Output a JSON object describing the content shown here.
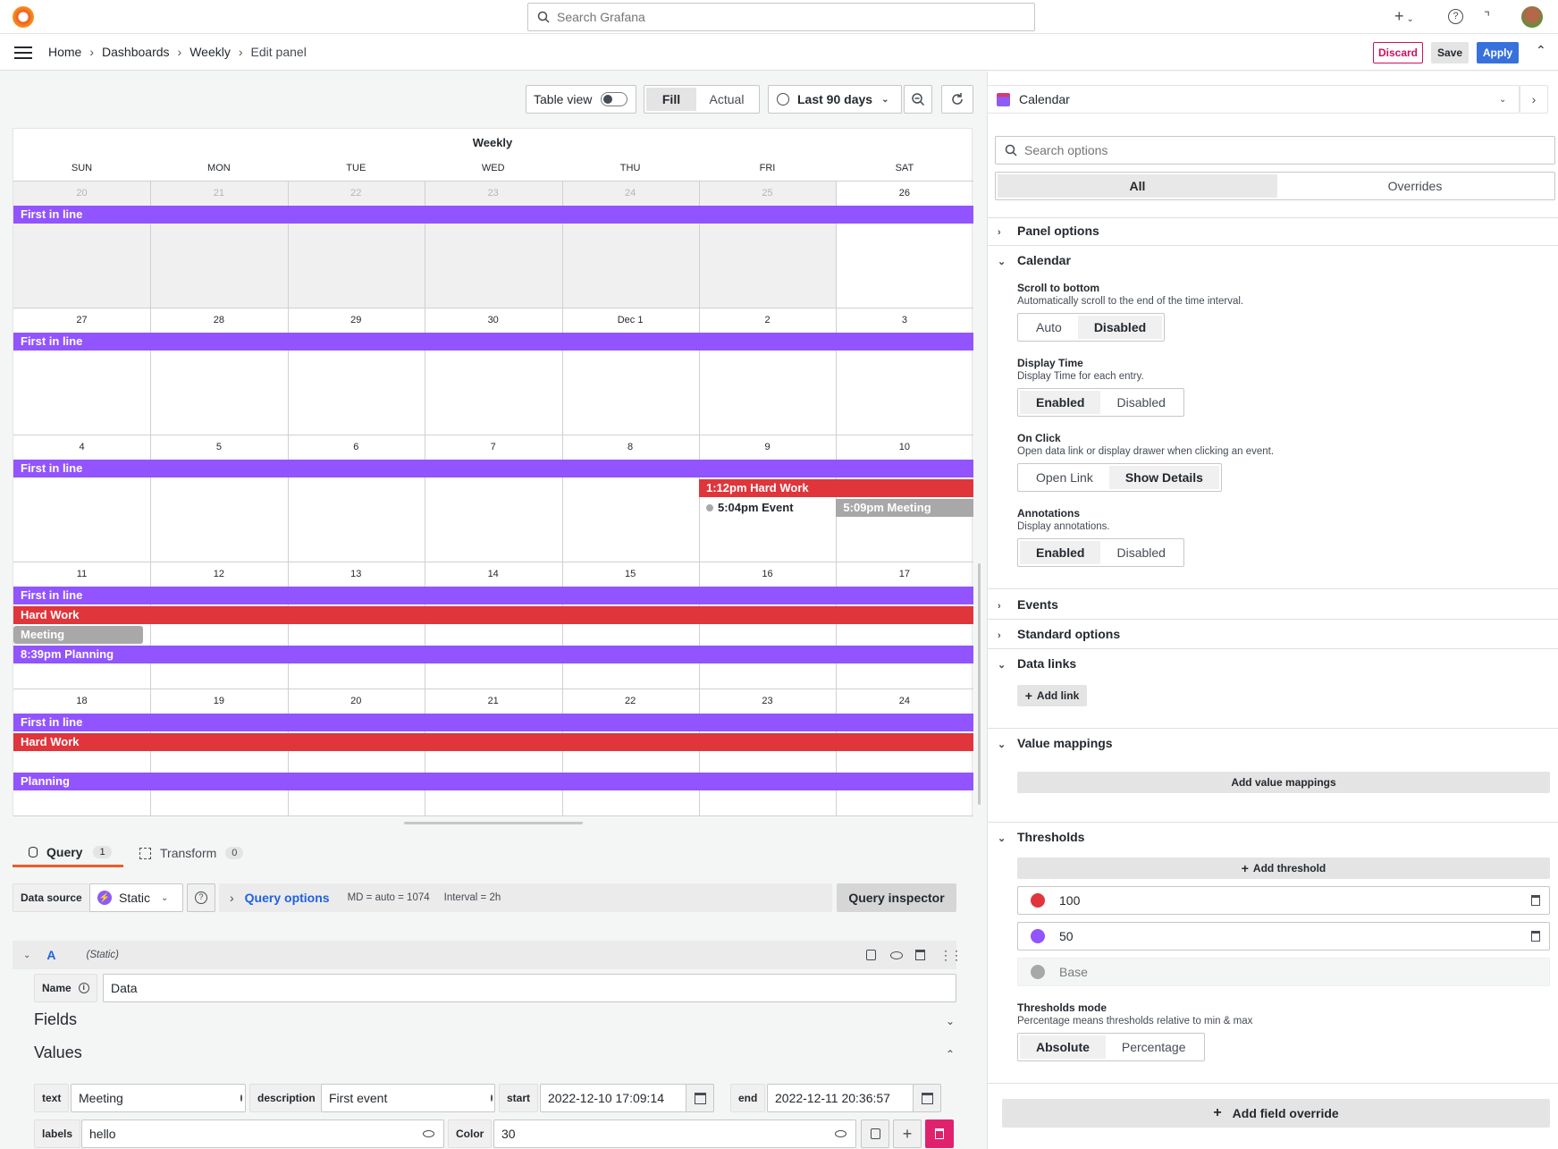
{
  "topbar": {
    "search_placeholder": "Search Grafana",
    "add_label": "+",
    "help_icon": "help-icon",
    "news_icon": "rss-icon"
  },
  "breadcrumb": [
    "Home",
    "Dashboards",
    "Weekly",
    "Edit panel"
  ],
  "actions": {
    "discard": "Discard",
    "save": "Save",
    "apply": "Apply"
  },
  "toolbar": {
    "table_view": "Table view",
    "fill": "Fill",
    "actual": "Actual",
    "time_range": "Last 90 days"
  },
  "viz": {
    "name": "Calendar"
  },
  "calendar": {
    "title": "Weekly",
    "weekdays": [
      "SUN",
      "MON",
      "TUE",
      "WED",
      "THU",
      "FRI",
      "SAT"
    ],
    "weeks": [
      [
        "20",
        "21",
        "22",
        "23",
        "24",
        "25",
        "26"
      ],
      [
        "27",
        "28",
        "29",
        "30",
        "Dec 1",
        "2",
        "3"
      ],
      [
        "4",
        "5",
        "6",
        "7",
        "8",
        "9",
        "10"
      ],
      [
        "11",
        "12",
        "13",
        "14",
        "15",
        "16",
        "17"
      ],
      [
        "18",
        "19",
        "20",
        "21",
        "22",
        "23",
        "24"
      ]
    ],
    "events": {
      "first_in_line": "First in line",
      "hard_work_timed": "1:12pm Hard Work",
      "event_timed": "5:04pm Event",
      "meeting_timed": "5:09pm Meeting",
      "hard_work": "Hard Work",
      "meeting": "Meeting",
      "planning_timed": "8:39pm Planning",
      "planning": "Planning"
    }
  },
  "colors": {
    "purple": "#9254fe",
    "red": "#e0353b",
    "gray": "#a8a8a8",
    "primary": "#3871dc",
    "discard": "#d10e5c"
  },
  "tabs": {
    "query": "Query",
    "query_count": "1",
    "transform": "Transform",
    "transform_count": "0"
  },
  "query": {
    "datasource_label": "Data source",
    "datasource": "Static",
    "options_label": "Query options",
    "md": "MD = auto = 1074",
    "interval": "Interval = 2h",
    "inspector": "Query inspector",
    "ref": "A",
    "ref_type": "(Static)",
    "name_label": "Name",
    "name_value": "Data",
    "fields": "Fields",
    "values": "Values",
    "text_label": "text",
    "text_value": "Meeting",
    "description_label": "description",
    "description_value": "First event",
    "start_label": "start",
    "start_value": "2022-12-10 17:09:14",
    "end_label": "end",
    "end_value": "2022-12-11 20:36:57",
    "labels_label": "labels",
    "labels_value": "hello",
    "color_label": "Color",
    "color_value": "30"
  },
  "options": {
    "search_placeholder": "Search options",
    "all": "All",
    "overrides": "Overrides",
    "panel_options": "Panel options",
    "calendar": "Calendar",
    "scroll_label": "Scroll to bottom",
    "scroll_desc": "Automatically scroll to the end of the time interval.",
    "scroll_auto": "Auto",
    "scroll_disabled": "Disabled",
    "display_time_label": "Display Time",
    "display_time_desc": "Display Time for each entry.",
    "enabled": "Enabled",
    "disabled": "Disabled",
    "on_click_label": "On Click",
    "on_click_desc": "Open data link or display drawer when clicking an event.",
    "open_link": "Open Link",
    "show_details": "Show Details",
    "annotations_label": "Annotations",
    "annotations_desc": "Display annotations.",
    "events": "Events",
    "standard_options": "Standard options",
    "data_links": "Data links",
    "add_link": "Add link",
    "value_mappings": "Value mappings",
    "add_value_mappings": "Add value mappings",
    "thresholds": "Thresholds",
    "add_threshold": "Add threshold",
    "threshold_values": [
      "100",
      "50",
      "Base"
    ],
    "thresholds_mode_label": "Thresholds mode",
    "thresholds_mode_desc": "Percentage means thresholds relative to min & max",
    "absolute": "Absolute",
    "percentage": "Percentage",
    "add_field_override": "Add field override"
  }
}
